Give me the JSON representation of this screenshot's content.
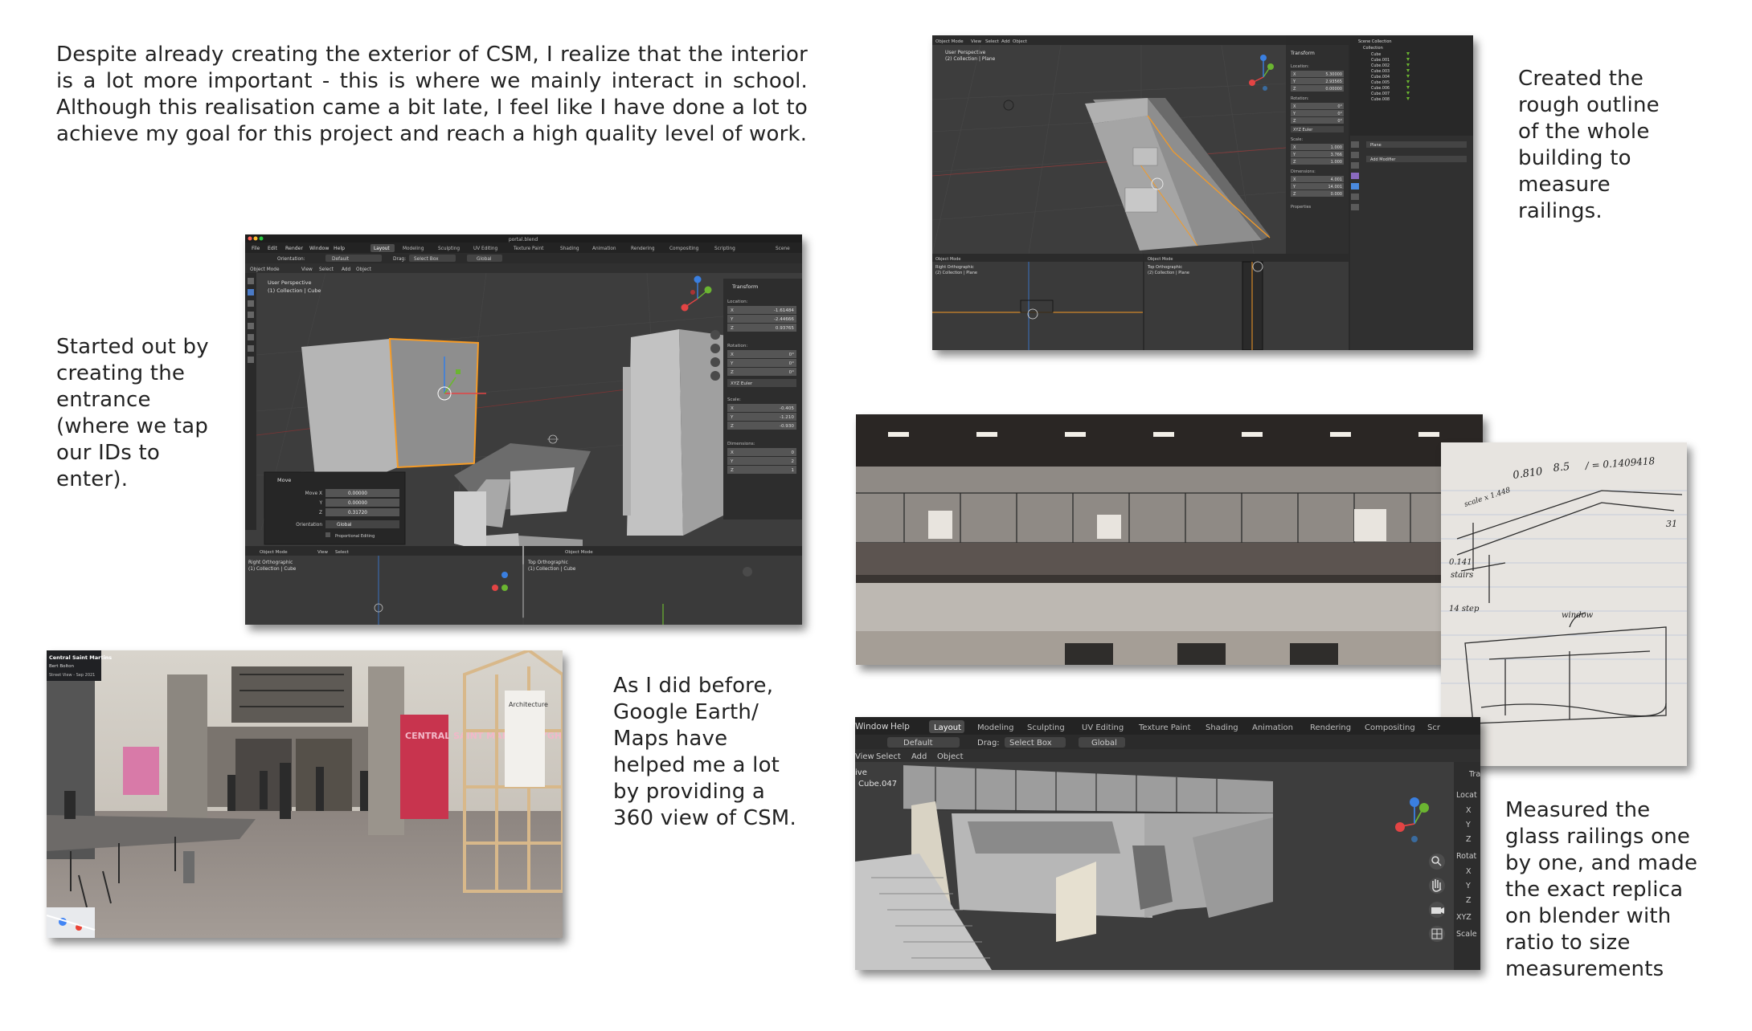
{
  "texts": {
    "intro": "Despite already creating the exterior of CSM, I realize that the interior is a lot more important - this is where we mainly interact in school. Although this realisation came a bit late, I feel like I have done a lot to achieve my goal for this project and reach a high quality level of work.",
    "outline": "Created the rough outline of the whole building to measure railings.",
    "entrance": "Started out by creating the entrance (where we tap our IDs to enter).",
    "google": "As I did before, Google Earth/ Maps have helped me a lot by providing a 360 view of CSM.",
    "measured": "Measured the glass railings one by one, and made the exact replica on blender with ratio to size measurements"
  },
  "blender_entrance": {
    "title": "portal.blend",
    "menus": [
      "File",
      "Edit",
      "Render",
      "Window",
      "Help"
    ],
    "tabs": [
      "Layout",
      "Modeling",
      "Sculpting",
      "UV Editing",
      "Texture Paint",
      "Shading",
      "Animation",
      "Rendering",
      "Compositing",
      "Scripting"
    ],
    "scene": "Scene",
    "orientation_label": "Orientation:",
    "orientation_value": "Default",
    "drag_label": "Drag:",
    "drag_value": "Select Box",
    "global": "Global",
    "mode": "Object Mode",
    "view_menus": [
      "View",
      "Select",
      "Add",
      "Object"
    ],
    "viewport_title": "User Perspective",
    "viewport_sub": "(1) Collection | Cube",
    "panel_title": "Transform",
    "location_label": "Location:",
    "location": [
      [
        "X",
        "-1.61484"
      ],
      [
        "Y",
        "-2.44666"
      ],
      [
        "Z",
        "0.93765"
      ]
    ],
    "rotation_label": "Rotation:",
    "rotation": [
      [
        "X",
        "0°"
      ],
      [
        "Y",
        "0°"
      ],
      [
        "Z",
        "0°"
      ]
    ],
    "euler": "XYZ Euler",
    "scale_label": "Scale:",
    "scale": [
      [
        "X",
        "-0.405"
      ],
      [
        "Y",
        "-1.210"
      ],
      [
        "Z",
        "-0.930"
      ]
    ],
    "dimensions_label": "Dimensions:",
    "dimensions": [
      [
        "X",
        "0"
      ],
      [
        "Y",
        "2"
      ],
      [
        "Z",
        "1"
      ]
    ],
    "move_title": "Move",
    "move": [
      [
        "Move X",
        "0.00000"
      ],
      [
        "Y",
        "0.00000"
      ],
      [
        "Z",
        "0.31720"
      ]
    ],
    "move_orientation_label": "Orientation",
    "move_orientation": "Global",
    "proportional": "Proportional Editing",
    "bottom_left_title": "Right Orthographic",
    "bottom_left_sub": "(1) Collection | Cube",
    "bottom_right_title": "Top Orthographic",
    "bottom_right_sub": "(1) Collection | Cube"
  },
  "blender_outline": {
    "mode": "Object Mode",
    "view_menus": [
      "View",
      "Select",
      "Add",
      "Object"
    ],
    "viewport_title": "User Perspective",
    "viewport_sub": "(2) Collection | Plane",
    "panel_title": "Transform",
    "location_label": "Location:",
    "location": [
      [
        "X",
        "5.30000"
      ],
      [
        "Y",
        "2.93565"
      ],
      [
        "Z",
        "0.00000"
      ]
    ],
    "rotation_label": "Rotation:",
    "rotation": [
      [
        "X",
        "0°"
      ],
      [
        "Y",
        "0°"
      ],
      [
        "Z",
        "0°"
      ]
    ],
    "euler": "XYZ Euler",
    "scale_label": "Scale:",
    "scale": [
      [
        "X",
        "1.000"
      ],
      [
        "Y",
        "3.766"
      ],
      [
        "Z",
        "1.000"
      ]
    ],
    "dimensions_label": "Dimensions:",
    "dimensions": [
      [
        "X",
        "4.001"
      ],
      [
        "Y",
        "14.001"
      ],
      [
        "Z",
        "0.000"
      ]
    ],
    "properties": "Properties",
    "collection_title": "Scene Collection",
    "collection_root": "Collection",
    "collection_items": [
      "Cube",
      "Cube.001",
      "Cube.002",
      "Cube.003",
      "Cube.004",
      "Cube.005",
      "Cube.006",
      "Cube.007",
      "Cube.008"
    ],
    "modifier_target": "Plane",
    "add_modifier": "Add Modifier",
    "bottom_left_title": "Right Orthographic",
    "bottom_left_sub": "(2) Collection | Plane",
    "bottom_right_title": "Top Orthographic",
    "bottom_right_sub": "(2) Collection | Plane"
  },
  "streetview": {
    "place": "Central Saint Martins",
    "author": "Bert Bolton",
    "date": "Street View - Sep 2021",
    "sign": "CENTRAL SAINT MARTINS BYGHT SHOW",
    "board": "Architecture"
  },
  "sketch": {
    "top": "0.810",
    "top2": "8.5",
    "ratio": "/ = 0.1409418",
    "scale": "scale x 1.448",
    "note1": "0.141",
    "note2": "stairs",
    "note3": "14 step",
    "note4": "window",
    "side": "31"
  },
  "blender_railings": {
    "menus": [
      "Window",
      "Help"
    ],
    "tabs": [
      "Layout",
      "Modeling",
      "Sculpting",
      "UV Editing",
      "Texture Paint",
      "Shading",
      "Animation",
      "Rendering",
      "Compositing",
      "Scr"
    ],
    "orientation_value": "Default",
    "drag_label": "Drag:",
    "drag_value": "Select Box",
    "global": "Global",
    "view_menus": [
      "View",
      "Select",
      "Add",
      "Object"
    ],
    "viewport_title": "ive",
    "viewport_sub": "Cube.047",
    "panel_rows": [
      "Tra",
      "Locat",
      "X",
      "Y",
      "Z",
      "Rotat",
      "X",
      "Y",
      "Z",
      "XYZ",
      "Scale"
    ]
  },
  "colors": {
    "blender_bg": "#3d3d3d",
    "blender_header": "#2b2b2b",
    "accent_orange": "#f59b26",
    "axis_red": "#e34444",
    "axis_green": "#6bb531",
    "axis_blue": "#3a7fe0",
    "tab_active": "#4b4b4b"
  }
}
